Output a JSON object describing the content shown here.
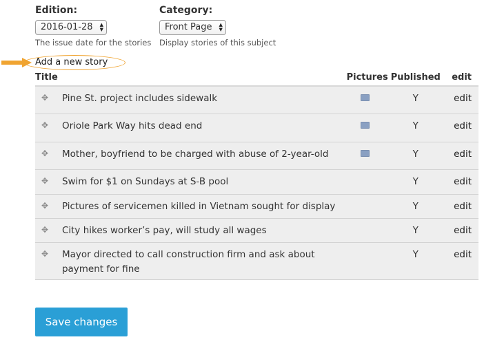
{
  "filters": {
    "edition": {
      "label": "Edition:",
      "value": "2016-01-28",
      "help": "The issue date for the stories"
    },
    "category": {
      "label": "Category:",
      "value": "Front Page",
      "help": "Display stories of this subject"
    }
  },
  "add_story": {
    "label": "Add a new story"
  },
  "table": {
    "headers": {
      "title": "Title",
      "pictures": "Pictures",
      "published": "Published",
      "edit": "edit"
    },
    "rows": [
      {
        "title": "Pine St. project includes sidewalk",
        "has_picture": true,
        "published": "Y",
        "edit": "edit"
      },
      {
        "title": "Oriole Park Way hits dead end",
        "has_picture": true,
        "published": "Y",
        "edit": "edit"
      },
      {
        "title": "Mother, boyfriend to be charged with abuse of 2-year-old",
        "has_picture": true,
        "published": "Y",
        "edit": "edit"
      },
      {
        "title": "Swim for $1 on Sundays at S-B pool",
        "has_picture": false,
        "published": "Y",
        "edit": "edit"
      },
      {
        "title": "Pictures of servicemen killed in Vietnam sought for display",
        "has_picture": false,
        "published": "Y",
        "edit": "edit"
      },
      {
        "title": "City hikes worker’s pay, will study all wages",
        "has_picture": false,
        "published": "Y",
        "edit": "edit"
      },
      {
        "title": "Mayor directed to call construction firm and ask about payment for fine",
        "has_picture": false,
        "published": "Y",
        "edit": "edit"
      }
    ]
  },
  "save_button": {
    "label": "Save changes"
  },
  "colors": {
    "accent": "#2a9fd6",
    "highlight": "#f0a431",
    "row_bg": "#eeeeee"
  }
}
